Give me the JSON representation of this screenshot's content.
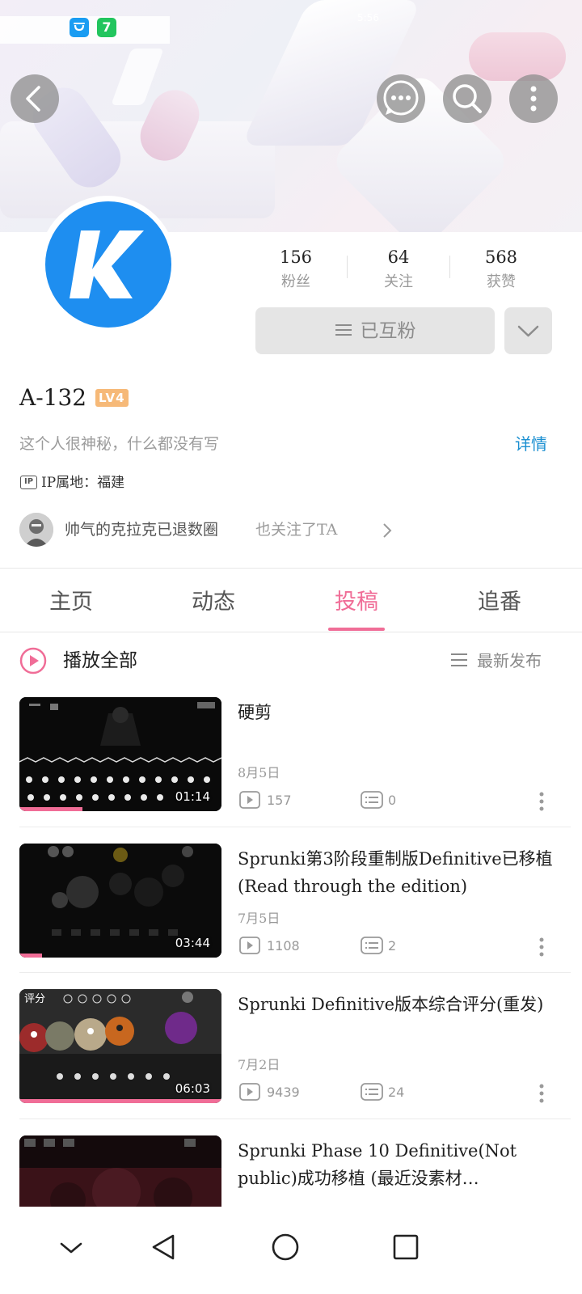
{
  "status_bar": {
    "time": "5:56",
    "apps": [
      {
        "name": "taobao",
        "color": "#1a9cf2",
        "glyph": "🛍"
      },
      {
        "name": "app-7",
        "color": "#22c55e",
        "glyph": "7"
      }
    ]
  },
  "header": {
    "icons": [
      "back-icon",
      "chat-icon",
      "search-icon",
      "more-icon"
    ]
  },
  "profile": {
    "avatar_letter": "K",
    "avatar_color": "#1e8ef0",
    "stats": [
      {
        "value": "156",
        "label": "粉丝"
      },
      {
        "value": "64",
        "label": "关注"
      },
      {
        "value": "568",
        "label": "获赞"
      }
    ],
    "follow_label": "已互粉",
    "username": "A-132",
    "level": "LV4",
    "bio": "这个人很神秘，什么都没有写",
    "detail_link": "详情",
    "ip_badge": "IP",
    "ip_location": "IP属地：福建",
    "mutual": {
      "name": "帅气的克拉克已退数圈",
      "suffix": "也关注了TA"
    }
  },
  "tabs": [
    {
      "label": "主页",
      "active": false
    },
    {
      "label": "动态",
      "active": false
    },
    {
      "label": "投稿",
      "active": true
    },
    {
      "label": "追番",
      "active": false
    }
  ],
  "list_header": {
    "play_all": "播放全部",
    "sort": "最新发布"
  },
  "videos": [
    {
      "title": "硬剪",
      "date": "8月5日",
      "views": "157",
      "comments": "0",
      "duration": "01:14",
      "progress": 0.31
    },
    {
      "title": "Sprunki第3阶段重制版Definitive已移植(Read through the edition)",
      "date": "7月5日",
      "views": "1108",
      "comments": "2",
      "duration": "03:44",
      "progress": 0.11
    },
    {
      "title": "Sprunki Definitive版本综合评分(重发)",
      "date": "7月2日",
      "views": "9439",
      "comments": "24",
      "duration": "06:03",
      "progress": 1.0
    },
    {
      "title": "Sprunki Phase 10 Definitive(Not public)成功移植 (最近没素材…",
      "date": "",
      "views": "",
      "comments": "",
      "duration": "",
      "progress": 0
    }
  ],
  "accent_color": "#f06d97",
  "navbar": [
    "chevron-down-icon",
    "nav-back-icon",
    "nav-home-icon",
    "nav-recents-icon"
  ]
}
